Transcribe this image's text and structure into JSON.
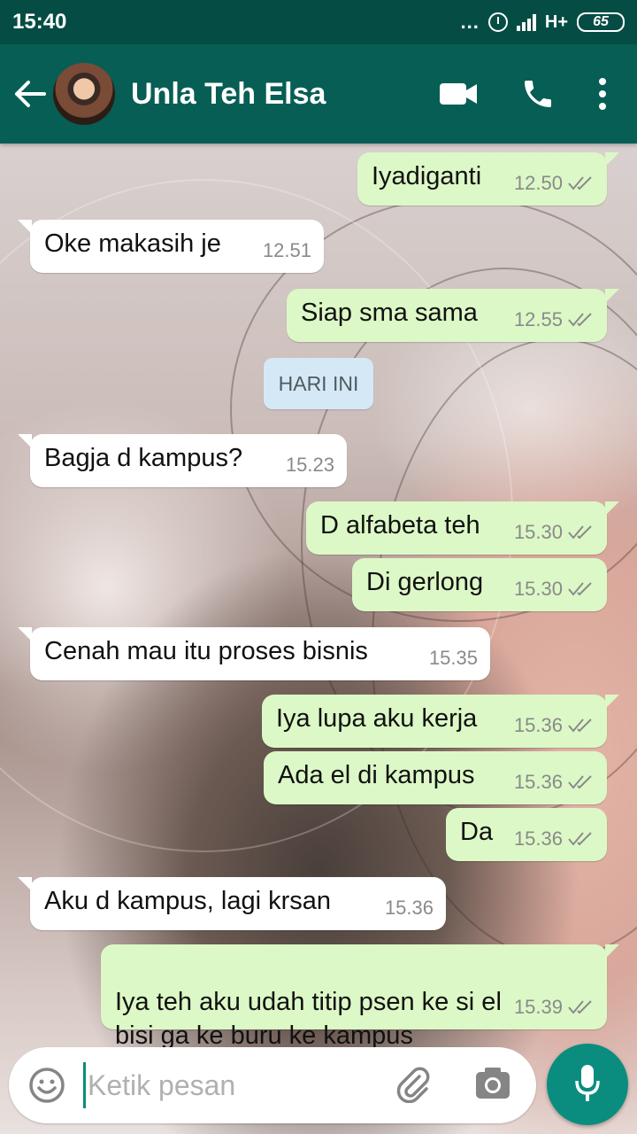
{
  "status_bar": {
    "time": "15:40",
    "network": "H+",
    "battery": "65",
    "dots": "..."
  },
  "header": {
    "contact_name": "Unla Teh Elsa"
  },
  "messages": [
    {
      "dir": "out",
      "text": "Iyadiganti",
      "time": "12.50"
    },
    {
      "dir": "in",
      "text": "Oke makasih je",
      "time": "12.51"
    },
    {
      "dir": "out",
      "text": "Siap sma sama",
      "time": "12.55"
    },
    {
      "dir": "in",
      "text": "Bagja d kampus?",
      "time": "15.23"
    },
    {
      "dir": "out",
      "text": "D alfabeta teh",
      "time": "15.30"
    },
    {
      "dir": "out",
      "text": "Di gerlong",
      "time": "15.30"
    },
    {
      "dir": "in",
      "text": "Cenah mau itu proses bisnis",
      "time": "15.35"
    },
    {
      "dir": "out",
      "text": "Iya lupa aku kerja",
      "time": "15.36"
    },
    {
      "dir": "out",
      "text": "Ada el di kampus",
      "time": "15.36"
    },
    {
      "dir": "out",
      "text": "Da",
      "time": "15.36"
    },
    {
      "dir": "in",
      "text": "Aku d kampus, lagi krsan",
      "time": "15.36"
    },
    {
      "dir": "out",
      "text": "Iya teh aku udah titip psen ke si el\nbisi ga ke buru ke kampus",
      "time": "15.39"
    }
  ],
  "day_divider": "HARI INI",
  "composer": {
    "placeholder": "Ketik pesan"
  },
  "colors": {
    "header": "#075e54",
    "status_bar": "#054d44",
    "outgoing": "#dcf8c6",
    "incoming": "#ffffff",
    "fab": "#0a8d7f",
    "chip": "#d4e9f5"
  },
  "icons": [
    "back-arrow-icon",
    "video-call-icon",
    "phone-icon",
    "more-vert-icon",
    "emoji-icon",
    "attach-icon",
    "camera-icon",
    "mic-icon",
    "double-tick-icon"
  ]
}
